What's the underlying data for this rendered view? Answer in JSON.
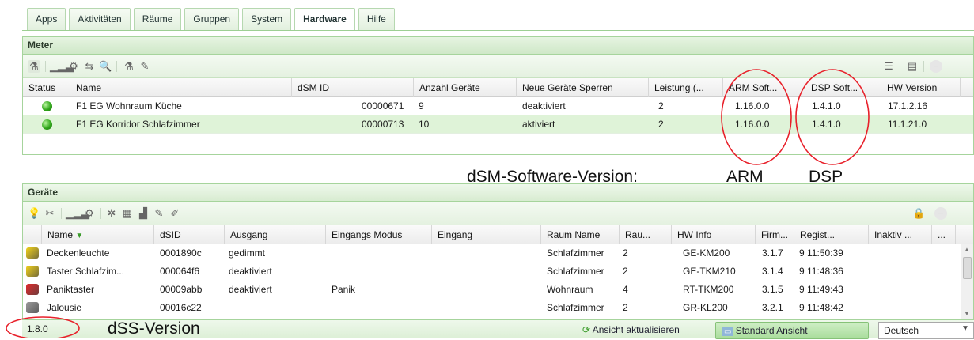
{
  "tabs": [
    "Apps",
    "Aktivitäten",
    "Räume",
    "Gruppen",
    "System",
    "Hardware",
    "Hilfe"
  ],
  "meter": {
    "title": "Meter",
    "columns": [
      "Status",
      "Name",
      "dSM ID",
      "Anzahl Geräte",
      "Neue Geräte Sperren",
      "Leistung (...",
      "ARM Soft...",
      "DSP Soft...",
      "HW Version"
    ],
    "rows": [
      {
        "name": "F1 EG Wohnraum Küche",
        "dsm_id": "00000671",
        "count": "9",
        "lock": "deaktiviert",
        "power": "2",
        "arm": "1.16.0.0",
        "dsp": "1.4.1.0",
        "hw": "17.1.2.16"
      },
      {
        "name": "F1 EG Korridor Schlafzimmer",
        "dsm_id": "00000713",
        "count": "10",
        "lock": "aktiviert",
        "power": "2",
        "arm": "1.16.0.0",
        "dsp": "1.4.1.0",
        "hw": "11.1.21.0"
      }
    ]
  },
  "devices": {
    "title": "Geräte",
    "columns": [
      "Name",
      "dSID",
      "Ausgang",
      "Eingangs Modus",
      "Eingang",
      "Raum Name",
      "Rau...",
      "HW Info",
      "Firm...",
      "Regist...",
      "Inaktiv ...",
      "..."
    ],
    "rows": [
      {
        "name": "Deckenleuchte",
        "dsid": "0001890c",
        "output": "gedimmt",
        "mode": "",
        "input": "",
        "room": "Schlafzimmer",
        "room_no": "2",
        "hw": "GE-KM200",
        "firm": "3.1.7",
        "reg": "9 11:50:39",
        "color": "#f2d21b"
      },
      {
        "name": "Taster Schlafzim...",
        "dsid": "000064f6",
        "output": "deaktiviert",
        "mode": "",
        "input": "",
        "room": "Schlafzimmer",
        "room_no": "2",
        "hw": "GE-TKM210",
        "firm": "3.1.4",
        "reg": "9 11:48:36",
        "color": "#f2d21b"
      },
      {
        "name": "Paniktaster",
        "dsid": "00009abb",
        "output": "deaktiviert",
        "mode": "Panik",
        "input": "",
        "room": "Wohnraum",
        "room_no": "4",
        "hw": "RT-TKM200",
        "firm": "3.1.5",
        "reg": "9 11:49:43",
        "color": "#e02b2b"
      },
      {
        "name": "Jalousie",
        "dsid": "00016c22",
        "output": "",
        "mode": "",
        "input": "",
        "room": "Schlafzimmer",
        "room_no": "2",
        "hw": "GR-KL200",
        "firm": "3.2.1",
        "reg": "9 11:48:42",
        "color": "#9a9a9a"
      }
    ]
  },
  "annotations": {
    "dsm_label": "dSM-Software-Version:",
    "arm": "ARM",
    "dsp": "DSP",
    "dss_label": "dSS-Version"
  },
  "statusbar": {
    "version": "1.8.0",
    "refresh_label": "Ansicht aktualisieren",
    "standard_view_label": "Standard Ansicht",
    "language": "Deutsch"
  }
}
